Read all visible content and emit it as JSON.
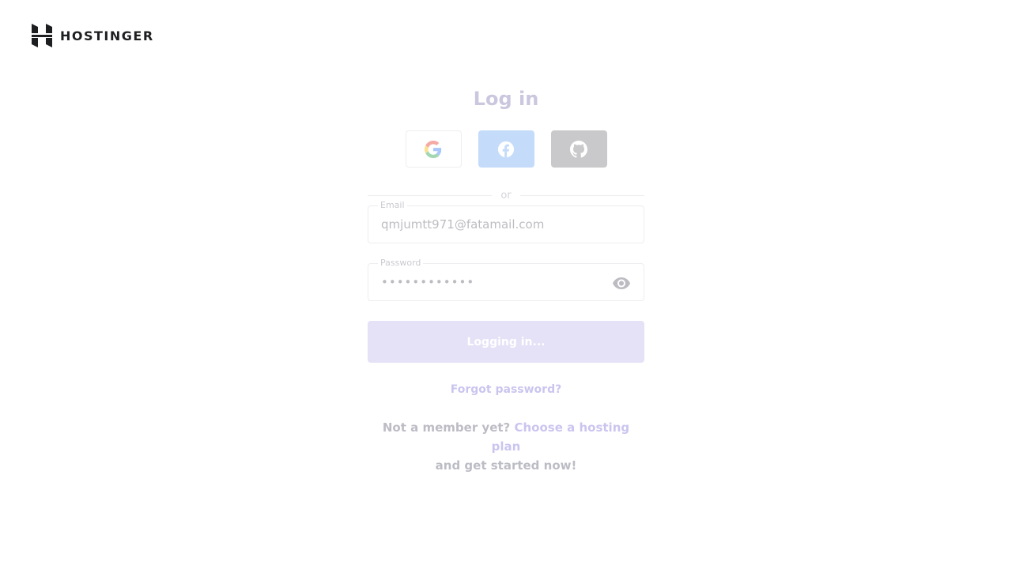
{
  "brand": {
    "name": "HOSTINGER",
    "color": "#1d1e20"
  },
  "login": {
    "title": "Log in",
    "social": [
      {
        "name": "google",
        "icon": "google-icon"
      },
      {
        "name": "facebook",
        "icon": "facebook-icon"
      },
      {
        "name": "github",
        "icon": "github-icon"
      }
    ],
    "divider_text": "or",
    "email": {
      "label": "Email",
      "value": "qmjumtt971@fatamail.com"
    },
    "password": {
      "label": "Password",
      "masked_value": "••••••••••••",
      "toggle_icon": "eye-icon"
    },
    "submit_label": "Logging in...",
    "forgot_label": "Forgot password?",
    "signup": {
      "prefix": "Not a member yet?",
      "link_text": "Choose a hosting plan",
      "suffix": "and get started now!"
    }
  },
  "colors": {
    "accent": "#673de6",
    "facebook": "#1877f2",
    "github": "#24292e"
  }
}
